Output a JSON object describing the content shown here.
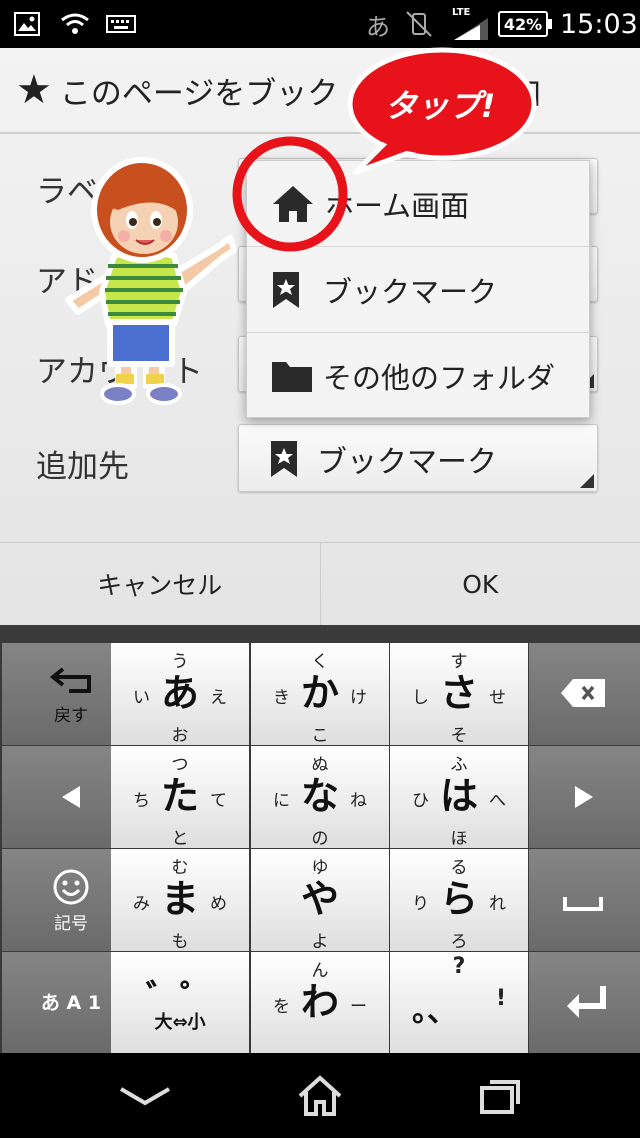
{
  "status": {
    "ime": "あ",
    "network": "LTE",
    "battery": "42%",
    "time": "15:03"
  },
  "dialog": {
    "title": "このページをブック",
    "title_tail": "加",
    "fields": [
      {
        "label": "ラベ"
      },
      {
        "label": "アド"
      },
      {
        "label": "アカウ",
        "label_tail": "ト"
      },
      {
        "label": "追加先",
        "value": "ブックマーク"
      }
    ],
    "popup_items": [
      {
        "label": "ホーム画面",
        "icon": "home-icon"
      },
      {
        "label": "ブックマーク",
        "icon": "bookmark-icon"
      },
      {
        "label": "その他のフォルダ",
        "icon": "folder-icon"
      }
    ],
    "cancel_label": "キャンセル",
    "ok_label": "OK"
  },
  "callout": "タップ!",
  "keyboard": {
    "rows": [
      {
        "left": {
          "label": "戻す",
          "icon": "undo-icon"
        },
        "keys": [
          {
            "c": "あ",
            "u": "う",
            "d": "お",
            "l": "い",
            "r": "え"
          },
          {
            "c": "か",
            "u": "く",
            "d": "こ",
            "l": "き",
            "r": "け"
          },
          {
            "c": "さ",
            "u": "す",
            "d": "そ",
            "l": "し",
            "r": "せ"
          }
        ],
        "right": {
          "icon": "backspace-icon"
        }
      },
      {
        "left": {
          "icon": "arrow-left-icon"
        },
        "keys": [
          {
            "c": "た",
            "u": "つ",
            "d": "と",
            "l": "ち",
            "r": "て"
          },
          {
            "c": "な",
            "u": "ぬ",
            "d": "の",
            "l": "に",
            "r": "ね"
          },
          {
            "c": "は",
            "u": "ふ",
            "d": "ほ",
            "l": "ひ",
            "r": "へ"
          }
        ],
        "right": {
          "icon": "arrow-right-icon"
        }
      },
      {
        "left": {
          "label": "記号",
          "icon": "smiley-icon"
        },
        "keys": [
          {
            "c": "ま",
            "u": "む",
            "d": "も",
            "l": "み",
            "r": "め"
          },
          {
            "c": "や",
            "u": "ゆ",
            "d": "よ",
            "l": "",
            "r": ""
          },
          {
            "c": "ら",
            "u": "る",
            "d": "ろ",
            "l": "り",
            "r": "れ"
          }
        ],
        "right": {
          "icon": "space-icon"
        }
      },
      {
        "left": {
          "label": "あ A 1",
          "icon": "input-mode-icon"
        },
        "keys": [
          {
            "c": "゛゜",
            "u": "",
            "d": "大⇔小",
            "l": "",
            "r": ""
          },
          {
            "c": "わ",
            "u": "ん",
            "d": "",
            "l": "を",
            "r": "ー"
          },
          {
            "c": "。、",
            "u": "?",
            "d": "",
            "l": "",
            "r": "!"
          }
        ],
        "right": {
          "icon": "enter-icon"
        }
      }
    ]
  },
  "nav": {
    "back_icon": "back-icon",
    "home_icon": "home-nav-icon",
    "recents_icon": "recents-icon"
  },
  "colors": {
    "callout_red": "#e8121b",
    "key_light": "#f4f4f4",
    "key_dark": "#767676"
  }
}
